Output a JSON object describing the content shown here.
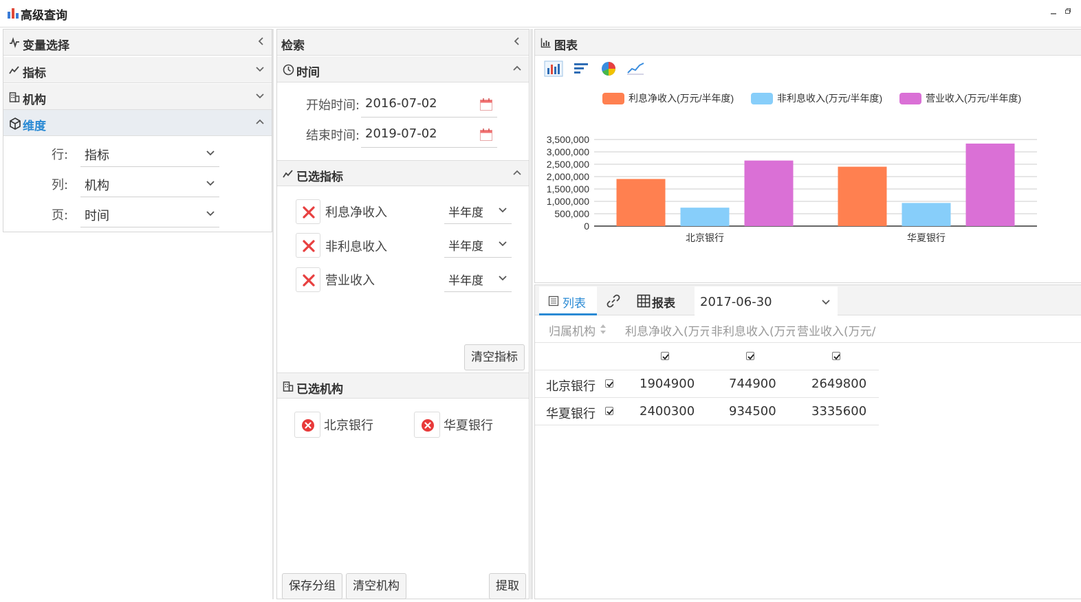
{
  "window": {
    "title": "高级查询"
  },
  "left_panel": {
    "title": "变量选择",
    "sections": [
      {
        "label": "指标"
      },
      {
        "label": "机构"
      },
      {
        "label": "维度"
      }
    ],
    "dimension_rows": [
      {
        "label": "行:",
        "value": "指标"
      },
      {
        "label": "列:",
        "value": "机构"
      },
      {
        "label": "页:",
        "value": "时间"
      }
    ]
  },
  "middle_panel": {
    "title": "检索",
    "time_section": {
      "title": "时间",
      "start_label": "开始时间:",
      "start_value": "2016-07-02",
      "end_label": "结束时间:",
      "end_value": "2019-07-02"
    },
    "indicators_section": {
      "title": "已选指标",
      "items": [
        {
          "name": "利息净收入",
          "period": "半年度"
        },
        {
          "name": "非利息收入",
          "period": "半年度"
        },
        {
          "name": "营业收入",
          "period": "半年度"
        }
      ],
      "clear_button": "清空指标"
    },
    "orgs_section": {
      "title": "已选机构",
      "items": [
        "北京银行",
        "华夏银行"
      ]
    },
    "footer": {
      "save_group": "保存分组",
      "clear_orgs": "清空机构",
      "extract": "提取"
    }
  },
  "chart_panel": {
    "title": "图表",
    "toolbar_icons": [
      "bar-chart-icon",
      "horizontal-bar-icon",
      "pie-chart-icon",
      "line-chart-icon"
    ]
  },
  "chart_data": {
    "type": "bar",
    "categories": [
      "北京银行",
      "华夏银行"
    ],
    "series": [
      {
        "name": "利息净收入(万元/半年度)",
        "values": [
          1904900,
          2400300
        ],
        "color": "#ff8050"
      },
      {
        "name": "非利息收入(万元/半年度)",
        "values": [
          744900,
          934500
        ],
        "color": "#87cefa"
      },
      {
        "name": "营业收入(万元/半年度)",
        "values": [
          2649800,
          3335600
        ],
        "color": "#da70d6"
      }
    ],
    "y_ticks": [
      "0",
      "500,000",
      "1,000,000",
      "1,500,000",
      "2,000,000",
      "2,500,000",
      "3,000,000",
      "3,500,000"
    ],
    "ylim": [
      0,
      3500000
    ],
    "grid": true,
    "legend_position": "top"
  },
  "table_panel": {
    "tabs": {
      "list": "列表",
      "report": "报表"
    },
    "date_select": "2017-06-30",
    "headers": [
      "归属机构",
      "利息净收入(万元",
      "非利息收入(万元",
      "营业收入(万元/"
    ],
    "rows": [
      {
        "org": "北京银行",
        "values": [
          "1904900",
          "744900",
          "2649800"
        ]
      },
      {
        "org": "华夏银行",
        "values": [
          "2400300",
          "934500",
          "3335600"
        ]
      }
    ]
  }
}
